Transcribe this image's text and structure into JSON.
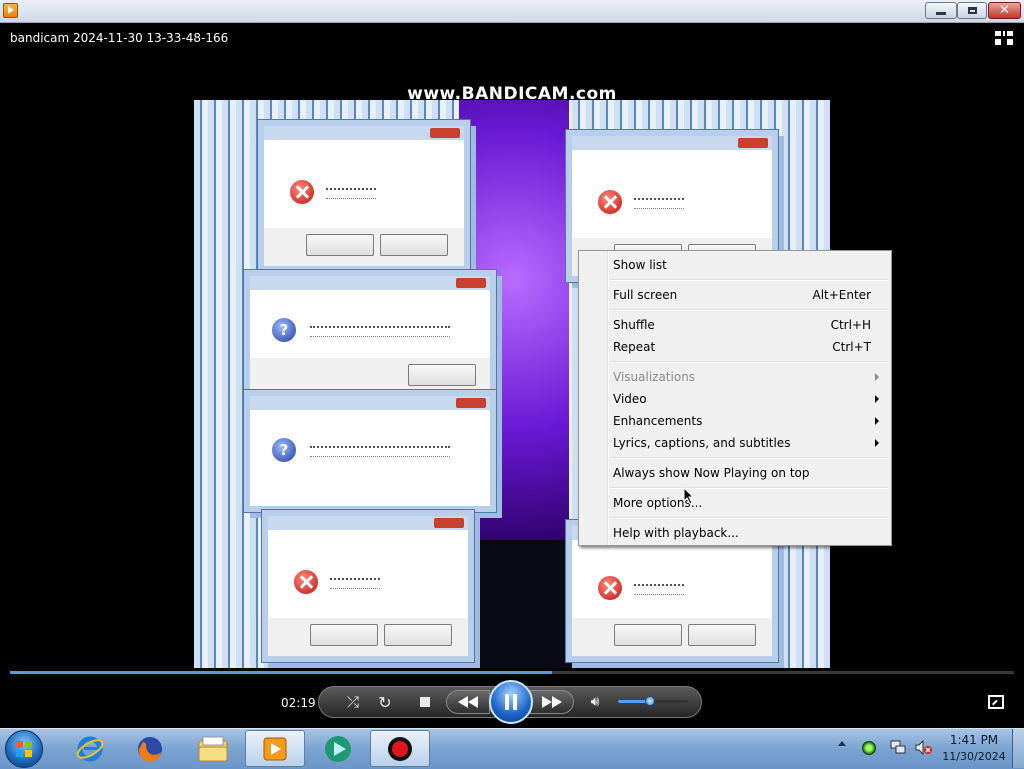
{
  "window": {
    "title": "",
    "controls": {
      "minimize": "minimize-icon",
      "maximize": "restore-icon",
      "close": "close-icon"
    }
  },
  "video": {
    "title": "bandicam 2024-11-30 13-33-48-166",
    "watermark": "www.BANDICAM.com"
  },
  "context_menu": {
    "items": [
      {
        "label": "Show list",
        "shortcut": ""
      },
      {
        "label": "Full screen",
        "shortcut": "Alt+Enter"
      },
      {
        "label": "Shuffle",
        "shortcut": "Ctrl+H"
      },
      {
        "label": "Repeat",
        "shortcut": "Ctrl+T"
      },
      {
        "label": "Visualizations",
        "shortcut": "",
        "submenu": true,
        "disabled": true
      },
      {
        "label": "Video",
        "shortcut": "",
        "submenu": true
      },
      {
        "label": "Enhancements",
        "shortcut": "",
        "submenu": true
      },
      {
        "label": "Lyrics, captions, and subtitles",
        "shortcut": "",
        "submenu": true
      },
      {
        "label": "Always show Now Playing on top",
        "shortcut": ""
      },
      {
        "label": "More options...",
        "shortcut": ""
      },
      {
        "label": "Help with playback...",
        "shortcut": ""
      }
    ]
  },
  "playback": {
    "elapsed": "02:19",
    "progress_fraction": 0.54,
    "volume_fraction": 0.46
  },
  "controls": {
    "shuffle_icon": "shuffle-icon",
    "repeat_icon": "repeat-icon",
    "stop_icon": "stop-icon",
    "previous_icon": "previous-icon",
    "play_pause_icon": "pause-icon",
    "next_icon": "next-icon",
    "mute_icon": "speaker-icon",
    "fullscreen_icon": "switch-to-library-icon"
  },
  "taskbar": {
    "apps": [
      "Internet Explorer",
      "Firefox",
      "Windows Explorer",
      "Windows Media Player",
      "Media app",
      "Bandicam"
    ],
    "clock_time": "1:41 PM",
    "clock_date": "11/30/2024"
  },
  "colors": {
    "accent": "#1b63c9",
    "seek_fill": "#5b9bd5",
    "taskbar": "#7aa3d1"
  }
}
